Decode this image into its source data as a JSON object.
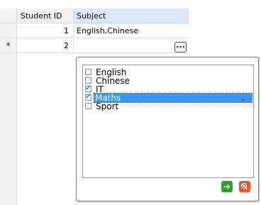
{
  "grid": {
    "columns": {
      "student_id": "Student ID",
      "subject": "Subject"
    },
    "rows": [
      {
        "indicator": "",
        "student_id": "1",
        "subject": "English,Chinese"
      },
      {
        "indicator": "*",
        "student_id": "2",
        "subject": ""
      }
    ],
    "ellipsis_label": "..."
  },
  "popup": {
    "options": [
      {
        "label": "English",
        "checked": false,
        "selected": false
      },
      {
        "label": "Chinese",
        "checked": false,
        "selected": false
      },
      {
        "label": "IT",
        "checked": true,
        "selected": false
      },
      {
        "label": "Maths",
        "checked": true,
        "selected": true
      },
      {
        "label": "Sport",
        "checked": false,
        "selected": false
      }
    ],
    "ok_icon": "arrow-right-icon",
    "cancel_icon": "no-entry-icon"
  }
}
